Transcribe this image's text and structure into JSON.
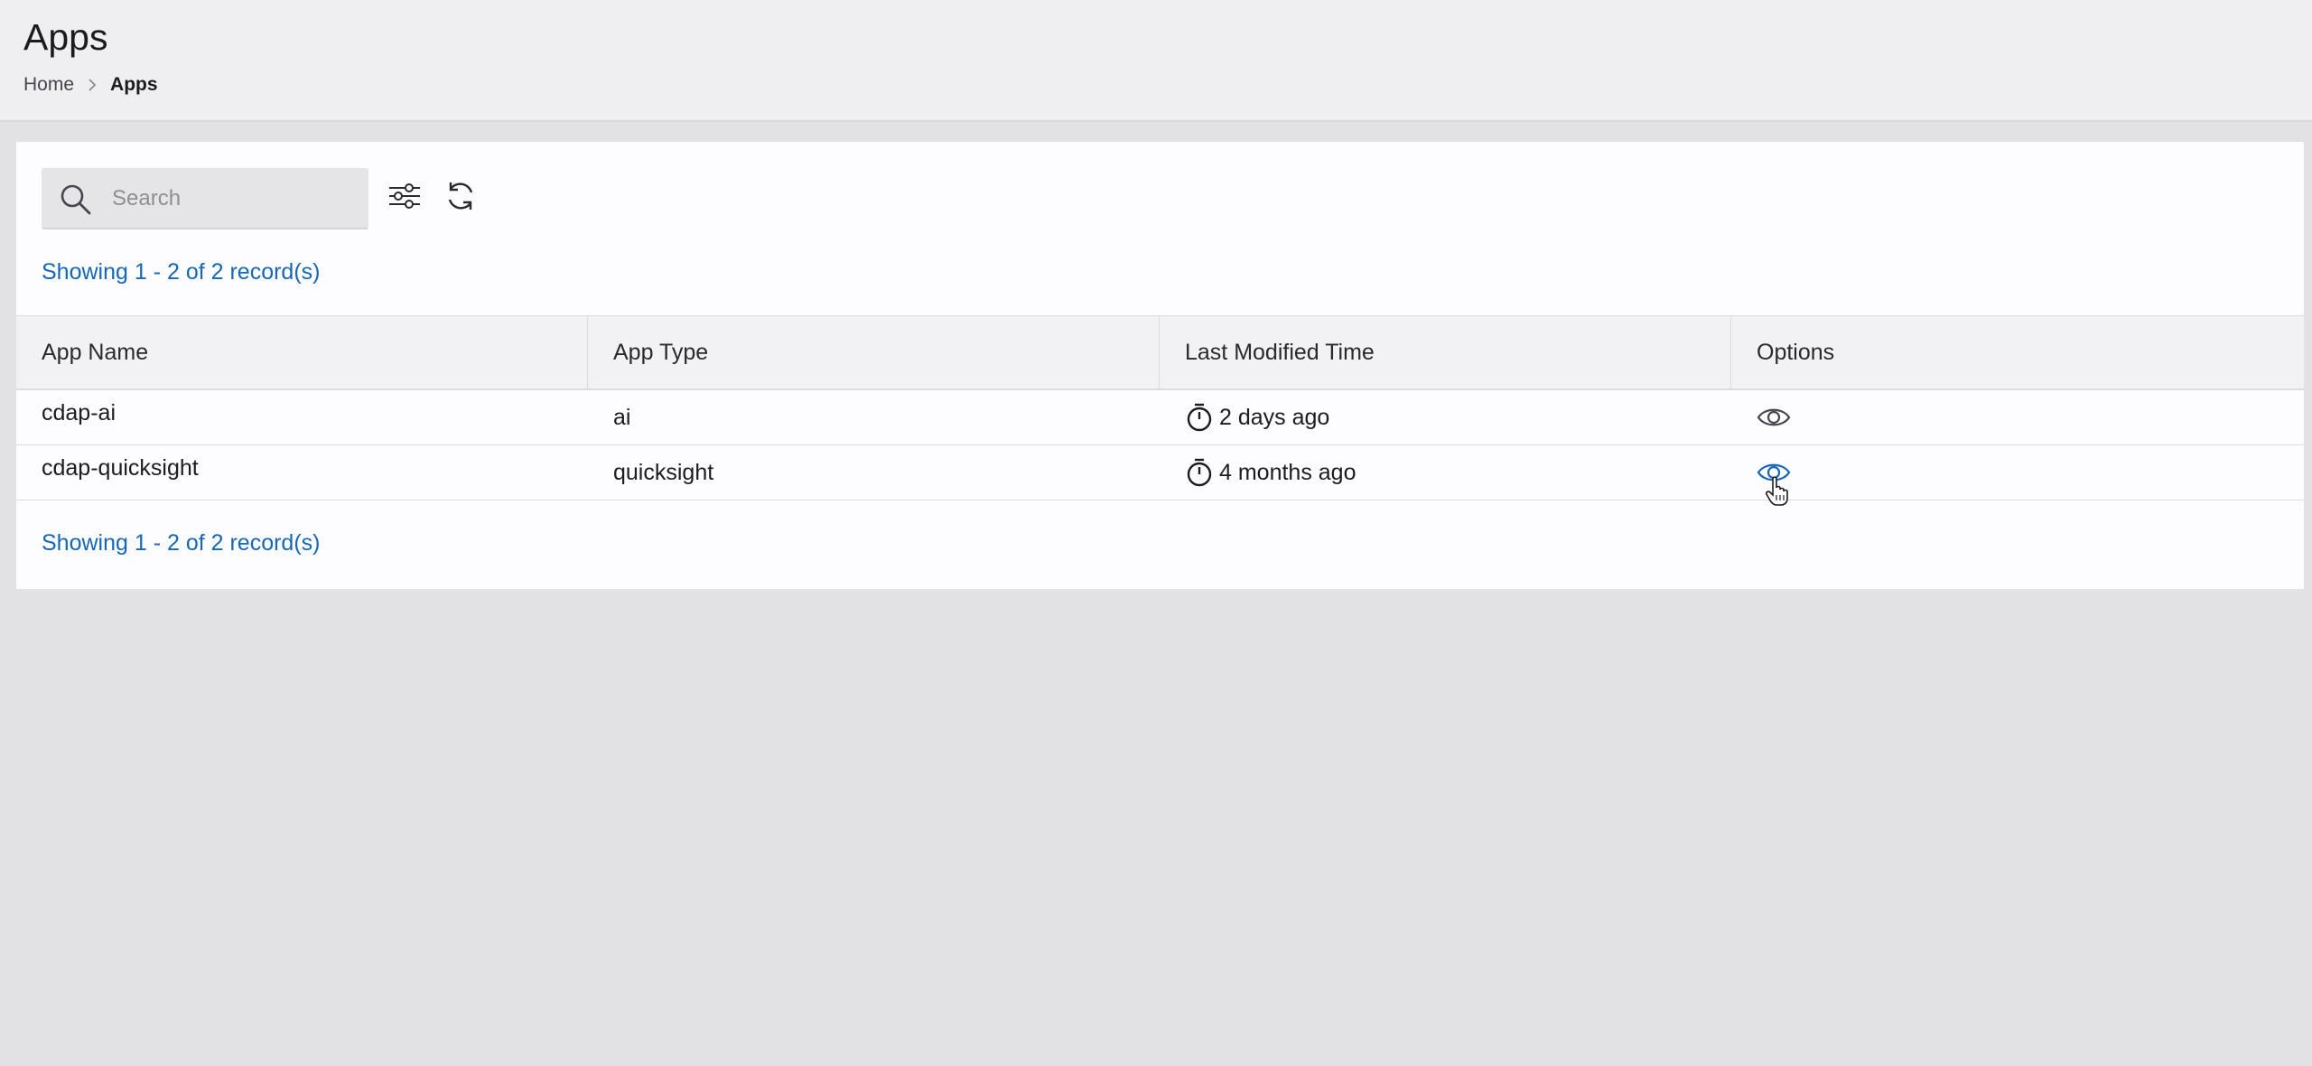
{
  "header": {
    "title": "Apps",
    "breadcrumb": {
      "home": "Home",
      "current": "Apps"
    }
  },
  "toolbar": {
    "search_placeholder": "Search",
    "search_value": "",
    "icons": [
      "search-icon",
      "filter-sliders-icon",
      "refresh-icon"
    ]
  },
  "records": {
    "top": "Showing 1 - 2 of 2 record(s)",
    "bottom": "Showing 1 - 2 of 2 record(s)"
  },
  "table": {
    "columns": [
      "App Name",
      "App Type",
      "Last Modified Time",
      "Options"
    ],
    "rows": [
      {
        "name": "cdap-ai",
        "type": "ai",
        "modified": "2 days ago",
        "option_icon": "eye-icon"
      },
      {
        "name": "cdap-quicksight",
        "type": "quicksight",
        "modified": "4 months ago",
        "option_icon": "eye-icon"
      }
    ]
  },
  "colors": {
    "accent": "#1667b5",
    "header_bg": "#efeef0",
    "page_bg": "#e2e1e3",
    "panel_bg": "#fdfcff"
  }
}
